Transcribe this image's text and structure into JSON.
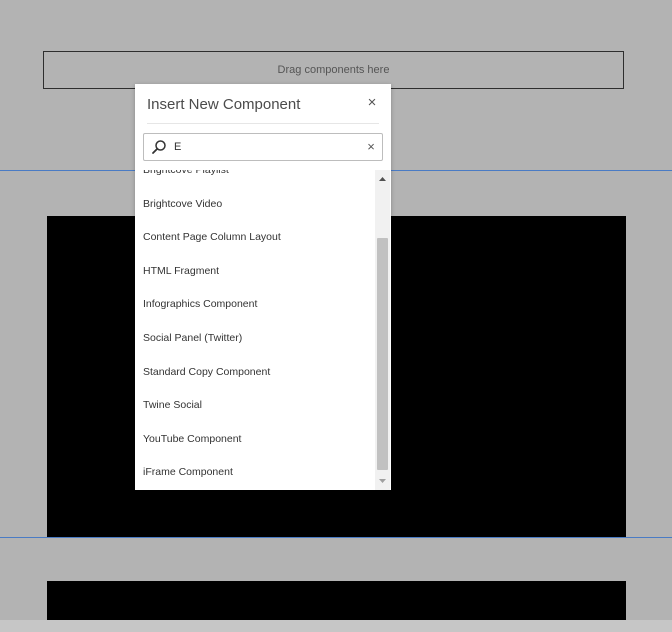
{
  "page": {
    "drop_zone_text": "Drag components here"
  },
  "dialog": {
    "title": "Insert New Component",
    "close_glyph": "×",
    "search": {
      "value": "E",
      "clear_glyph": "×"
    },
    "items": [
      "Brightcove Playlist",
      "Brightcove Video",
      "Content Page Column Layout",
      "HTML Fragment",
      "Infographics Component",
      "Social Panel (Twitter)",
      "Standard Copy Component",
      "Twine Social",
      "YouTube Component",
      "iFrame Component"
    ]
  },
  "colors": {
    "page_background": "#b3b3b3",
    "guide_line": "#4a7bc4",
    "component_placeholder": "#000000",
    "dialog_background": "#ffffff"
  },
  "icons": {
    "search": "magnifier-icon",
    "close": "close-icon",
    "clear": "clear-icon",
    "scroll_up": "arrow-up-icon",
    "scroll_down": "arrow-down-icon"
  }
}
